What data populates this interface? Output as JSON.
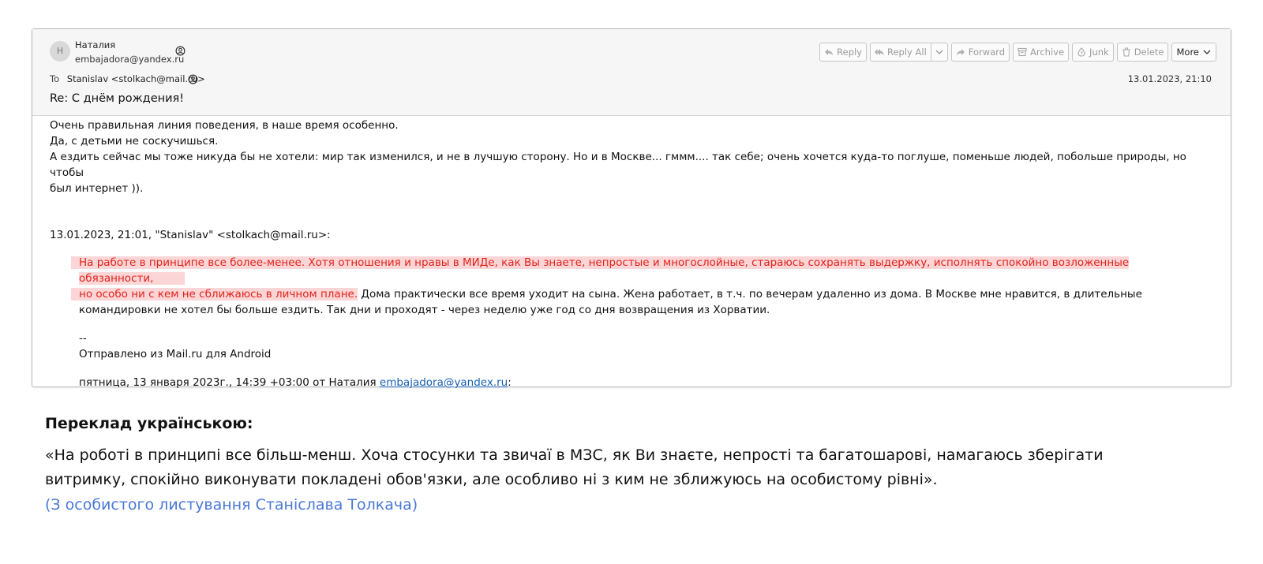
{
  "email": {
    "sender_initial": "Н",
    "sender_name": "Наталия",
    "sender_email": "embajadora@yandex.ru",
    "to_label": "To",
    "recipient": "Stanislav <stolkach@mail.ru>",
    "date": "13.01.2023, 21:10",
    "subject": "Re: С днём рождения!",
    "toolbar": {
      "reply": "Reply",
      "reply_all": "Reply All",
      "forward": "Forward",
      "archive": "Archive",
      "junk": "Junk",
      "delete": "Delete",
      "more": "More"
    },
    "body": {
      "line1": "Очень правильная линия поведения, в наше время особенно.",
      "line2": "Да, с детьми не соскучишься.",
      "line3": "А ездить сейчас  мы тоже никуда бы не хотели:  мир так изменился, и не в лучшую сторону. Но и в Москве... гммм.... так себе; очень хочется куда-то поглуше,  поменьше людей,  побольше природы, но чтобы",
      "line4": "был интернет )).",
      "quote_header": "13.01.2023, 21:01, \"Stanislav\" <stolkach@mail.ru>:",
      "quote_highlight_1": "На работе в принципе все более-менее. Хотя отношения и нравы в МИДе, как Вы знаете, непростые и многослойные, стараюсь сохранять выдержку, исполнять спокойно возложенные обязанности,",
      "quote_highlight_2": "но особо ни с кем не сближаюсь в личном плане.",
      "quote_rest_1": " Дома практически все время уходит на сына. Жена работает, в т.ч. по вечерам удаленно из дома. В Москве мне нравится, в длительные",
      "quote_rest_2": "командировки не хотел бы больше ездить. Так дни и проходят - через неделю уже год со дня возвращения из Хорватии.",
      "sig_sep": "--",
      "sig_text": "Отправлено из Mail.ru для Android",
      "sent_prefix": "пятница, 13 января 2023г., 14:39 +03:00 от Наталия ",
      "sent_link": "embajadora@yandex.ru",
      "sent_suffix": ":"
    }
  },
  "translation": {
    "title": "Переклад українською:",
    "line1": "«На роботі в принципі все більш-менш. Хоча стосунки та звичаї в МЗС, як Ви знаєте, непрості та багатошарові, намагаюсь зберігати",
    "line2": "витримку, спокійно виконувати покладені обов'язки, але особливо ні з ким не зближуюсь на особистому рівні».",
    "source": "(З особистого листування Станіслава Толкача)"
  },
  "colors": {
    "highlight_bg": "#fcd6d6",
    "highlight_text": "#e0221c",
    "link": "#1a5fb4",
    "source_note": "#4a78d6"
  }
}
